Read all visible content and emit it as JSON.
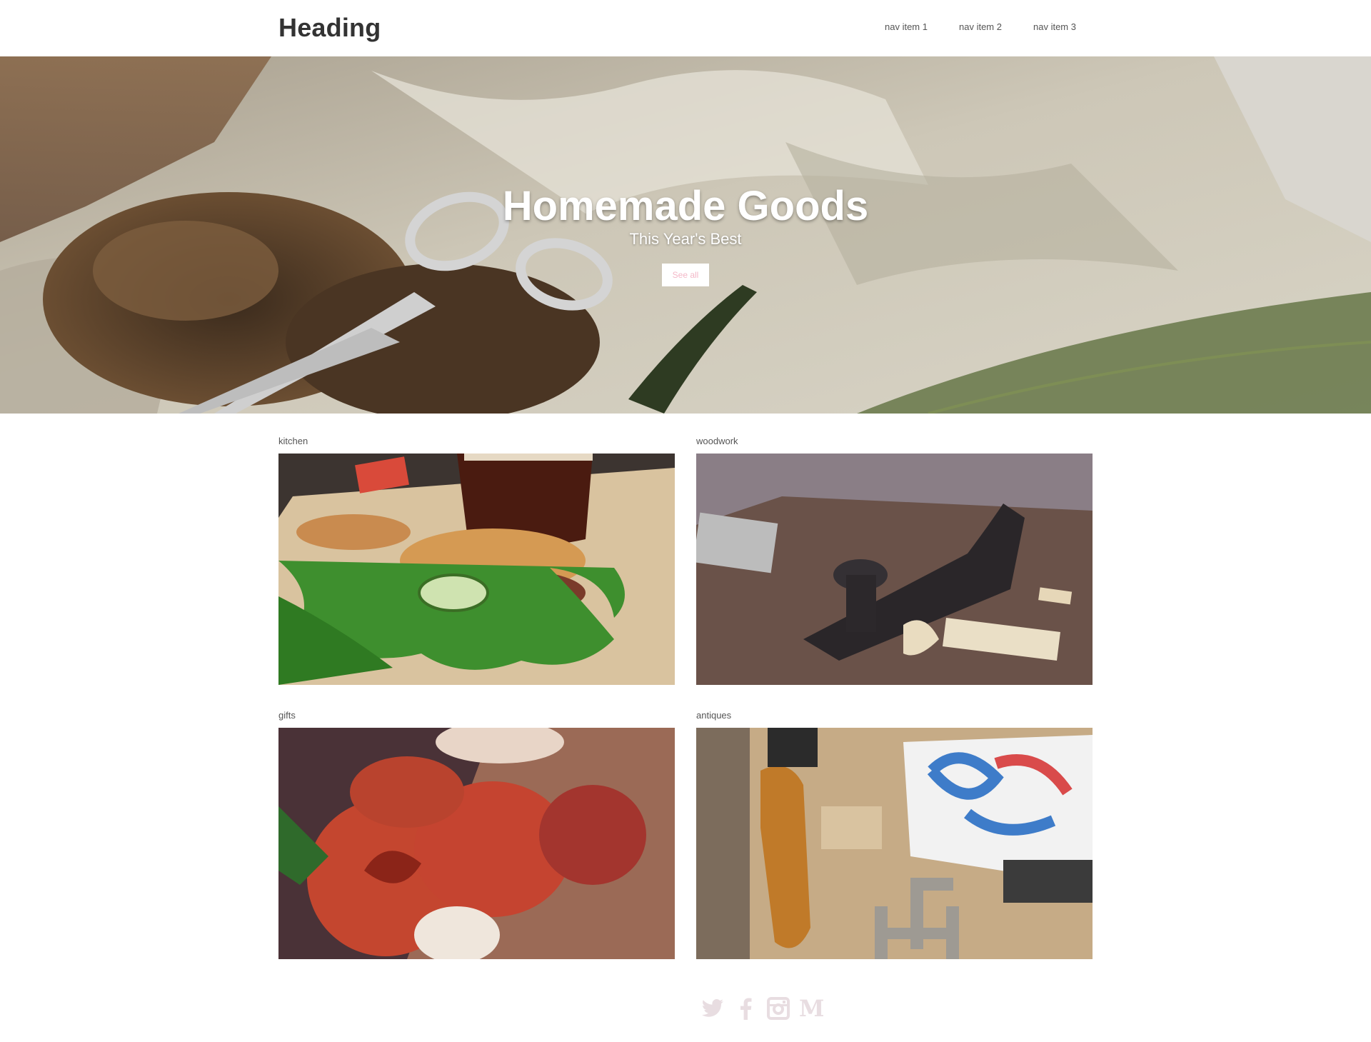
{
  "header": {
    "brand": "Heading",
    "nav": [
      "nav item 1",
      "nav item 2",
      "nav item 3"
    ]
  },
  "hero": {
    "title": "Homemade Goods",
    "subtitle": "This Year's Best",
    "button_label": "See all"
  },
  "categories": [
    {
      "label": "kitchen"
    },
    {
      "label": "woodwork"
    },
    {
      "label": "gifts"
    },
    {
      "label": "antiques"
    }
  ],
  "footer": {
    "icons": [
      "twitter-icon",
      "facebook-icon",
      "instagram-icon",
      "medium-icon"
    ],
    "icon_color": "#e8dde1"
  },
  "colors": {
    "button_text": "#f4b8c8",
    "brand": "#333333"
  }
}
